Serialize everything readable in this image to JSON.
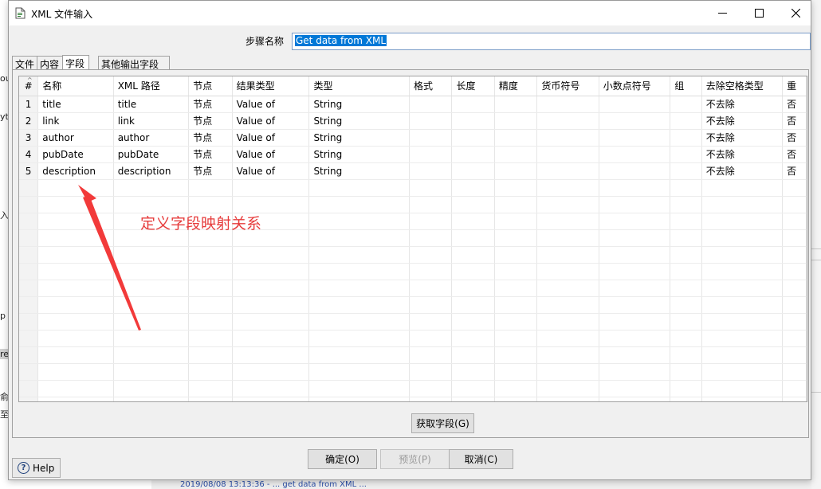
{
  "window": {
    "title": "XML 文件输入"
  },
  "step": {
    "label": "步骤名称",
    "value": "Get data from XML"
  },
  "tabs": [
    {
      "label": "文件",
      "active": false
    },
    {
      "label": "内容",
      "active": false
    },
    {
      "label": "字段",
      "active": true
    },
    {
      "label": "其他输出字段",
      "active": false
    }
  ],
  "table": {
    "columns": [
      "#",
      "名称",
      "XML 路径",
      "节点",
      "结果类型",
      "类型",
      "格式",
      "长度",
      "精度",
      "货币符号",
      "小数点符号",
      "组",
      "去除空格类型",
      "重"
    ],
    "rows": [
      [
        "1",
        "title",
        "title",
        "节点",
        "Value of",
        "String",
        "",
        "",
        "",
        "",
        "",
        "",
        "不去除",
        "否"
      ],
      [
        "2",
        "link",
        "link",
        "节点",
        "Value of",
        "String",
        "",
        "",
        "",
        "",
        "",
        "",
        "不去除",
        "否"
      ],
      [
        "3",
        "author",
        "author",
        "节点",
        "Value of",
        "String",
        "",
        "",
        "",
        "",
        "",
        "",
        "不去除",
        "否"
      ],
      [
        "4",
        "pubDate",
        "pubDate",
        "节点",
        "Value of",
        "String",
        "",
        "",
        "",
        "",
        "",
        "",
        "不去除",
        "否"
      ],
      [
        "5",
        "description",
        "description",
        "节点",
        "Value of",
        "String",
        "",
        "",
        "",
        "",
        "",
        "",
        "不去除",
        "否"
      ]
    ],
    "empty_rows": 14
  },
  "buttons": {
    "get_fields": "获取字段(G)",
    "ok": "确定(O)",
    "preview": "预览(P)",
    "cancel": "取消(C)",
    "help": "Help"
  },
  "annotation": {
    "text": "定义字段映射关系",
    "color": "#e63b3b"
  },
  "background": {
    "left_chars": [
      "ou",
      "yt",
      "入",
      "p",
      "re",
      "俞",
      "至"
    ],
    "bottom_log": "2019/08/08 13:13:36 - ... get data from XML ..."
  }
}
